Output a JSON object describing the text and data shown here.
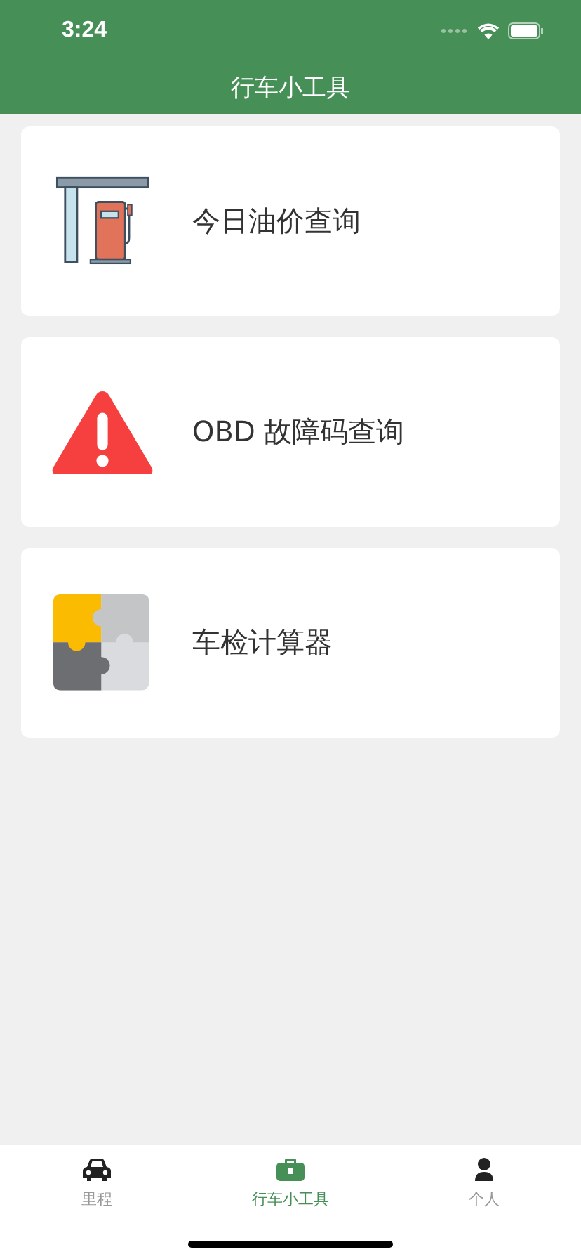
{
  "status_bar": {
    "time": "3:24"
  },
  "nav_bar": {
    "title": "行车小工具"
  },
  "tools": [
    {
      "kind": "fuel",
      "label": "今日油价查询"
    },
    {
      "kind": "warning",
      "label": "OBD 故障码查询"
    },
    {
      "kind": "puzzle",
      "label": "车检计算器"
    }
  ],
  "tab_bar": [
    {
      "kind": "car",
      "label": "里程",
      "selected": false
    },
    {
      "kind": "toolbox",
      "label": "行车小工具",
      "selected": true
    },
    {
      "kind": "person",
      "label": "个人",
      "selected": false
    }
  ]
}
